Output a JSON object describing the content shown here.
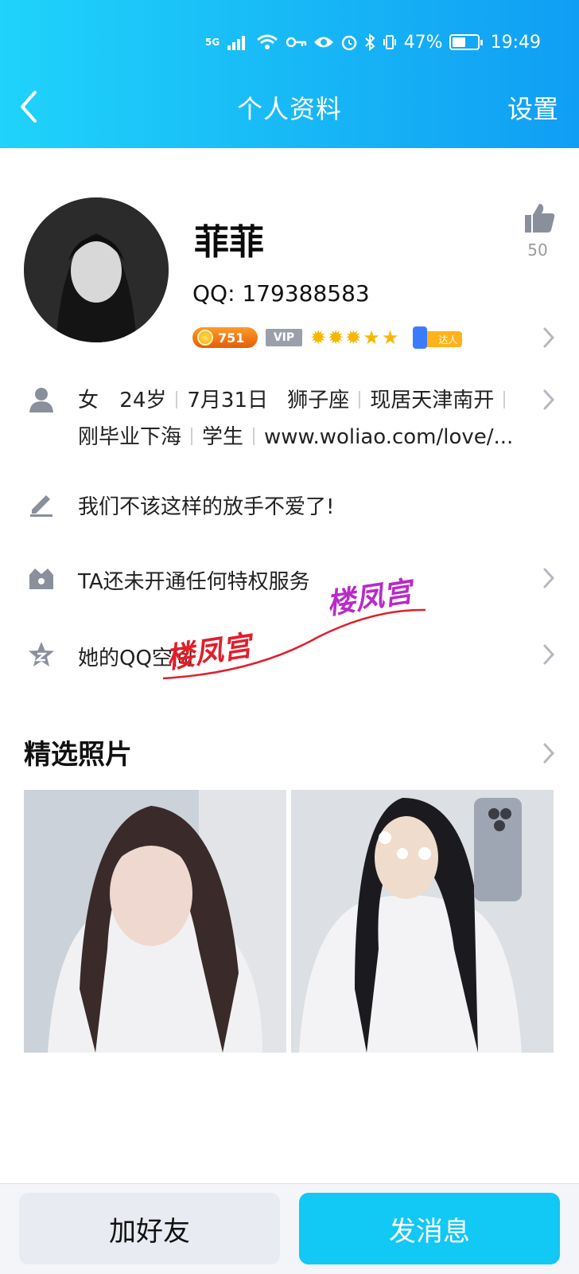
{
  "status_bar": {
    "network": "5G",
    "battery": "47%",
    "time": "19:49"
  },
  "header": {
    "title": "个人资料",
    "settings_label": "设置"
  },
  "profile": {
    "name": "菲菲",
    "qq": "QQ:  179388583",
    "likes": "50",
    "coin_level": "751",
    "vip_label": "VIP",
    "talent_label": "达人"
  },
  "info": {
    "line1": [
      "女",
      "24岁",
      "7月31日",
      "狮子座",
      "现居天津南开"
    ],
    "line2": [
      "刚毕业下海",
      "学生",
      "www.woliao.com/love/..."
    ]
  },
  "signature": "我们不该这样的放手不爱了!",
  "privilege": "TA还未开通任何特权服务",
  "qzone": "她的QQ空间",
  "watermarks": [
    "楼凤宫",
    "楼凤宫"
  ],
  "photos": {
    "title": "精选照片"
  },
  "actions": {
    "add_friend": "加好友",
    "send_message": "发消息"
  }
}
